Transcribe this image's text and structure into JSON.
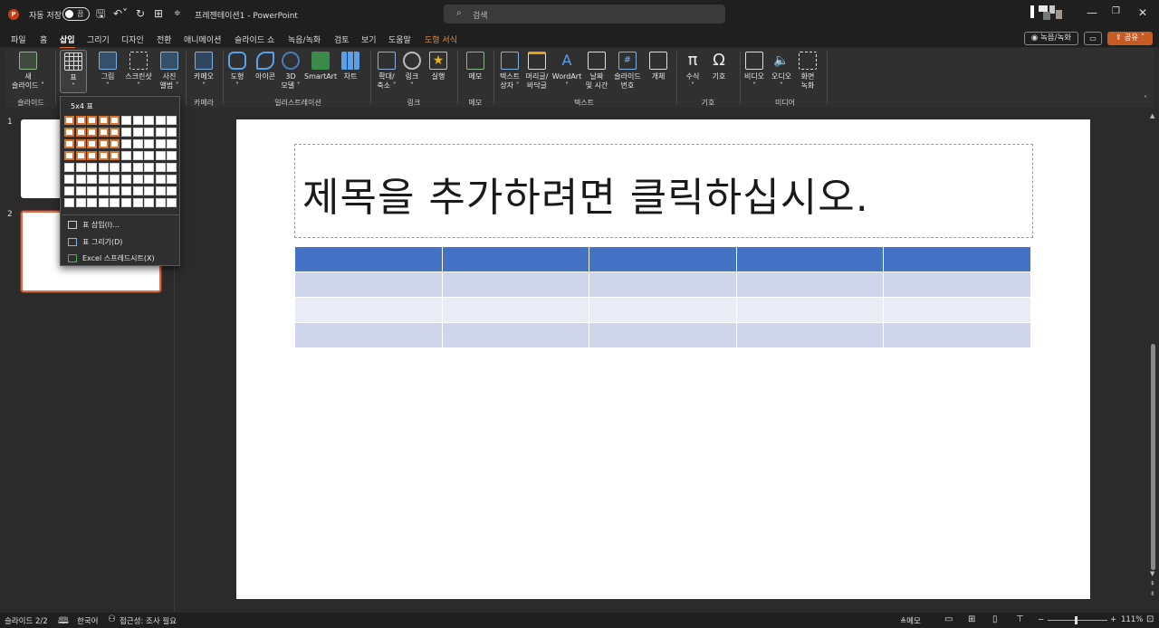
{
  "titlebar": {
    "app_badge": "P",
    "autosave_label": "자동 저장",
    "autosave_state": "끔",
    "filename": "프레젠테이션1 - PowerPoint",
    "search_placeholder": "검색"
  },
  "tabs": [
    "파일",
    "홈",
    "삽입",
    "그리기",
    "디자인",
    "전환",
    "애니메이션",
    "슬라이드 쇼",
    "녹음/녹화",
    "검토",
    "보기",
    "도움말",
    "도형 서식"
  ],
  "active_tab": "삽입",
  "header_buttons": {
    "record": "녹음/녹화",
    "share": "공유"
  },
  "ribbon": {
    "groups": {
      "slides": "슬라이드",
      "camera": "카메라",
      "illustrations": "일러스트레이션",
      "links": "링크",
      "comments": "메모",
      "text": "텍스트",
      "symbols": "기호",
      "media": "미디어"
    },
    "buttons": {
      "new_slide_1": "새",
      "new_slide_2": "슬라이드 ˅",
      "table": "표",
      "pictures": "그림",
      "screenshot": "스크린샷",
      "photo_album_1": "사진",
      "photo_album_2": "앨범 ˅",
      "cameo": "카메오",
      "shapes": "도형",
      "icons": "아이콘",
      "models_1": "3D",
      "models_2": "모델 ˅",
      "smartart": "SmartArt",
      "chart": "차트",
      "zoom_1": "확대/",
      "zoom_2": "축소 ˅",
      "link": "링크",
      "action": "실행",
      "comment": "메모",
      "textbox_1": "텍스트",
      "textbox_2": "상자 ˅",
      "header_footer_1": "머리글/",
      "header_footer_2": "바닥글",
      "wordart": "WordArt",
      "datetime_1": "날짜",
      "datetime_2": "및 시간",
      "slide_number_1": "슬라이드",
      "slide_number_2": "번호",
      "object": "개체",
      "equation": "수식",
      "symbol": "기호",
      "video": "비디오",
      "audio": "오디오",
      "screen_record_1": "화면",
      "screen_record_2": "녹화"
    }
  },
  "table_dropdown": {
    "size_label": "5x4 표",
    "selected_cols": 5,
    "selected_rows": 4,
    "grid_cols": 10,
    "grid_rows": 8,
    "items": [
      "표 삽입(I)...",
      "표 그리기(D)",
      "Excel 스프레드시트(X)"
    ]
  },
  "slides_panel": {
    "thumb_numbers": [
      "1",
      "2"
    ],
    "selected": 2
  },
  "slide": {
    "title_placeholder": "제목을 추가하려면 클릭하십시오.",
    "table": {
      "cols": 5,
      "rows": 4
    }
  },
  "statusbar": {
    "slide_info": "슬라이드 2/2",
    "language": "한국어",
    "accessibility": "접근성: 조사 필요",
    "notes": "메모",
    "zoom": "111%"
  },
  "colors": {
    "accent": "#c75b24",
    "table_header": "#4472c4",
    "grid_selection": "#d9742f"
  }
}
